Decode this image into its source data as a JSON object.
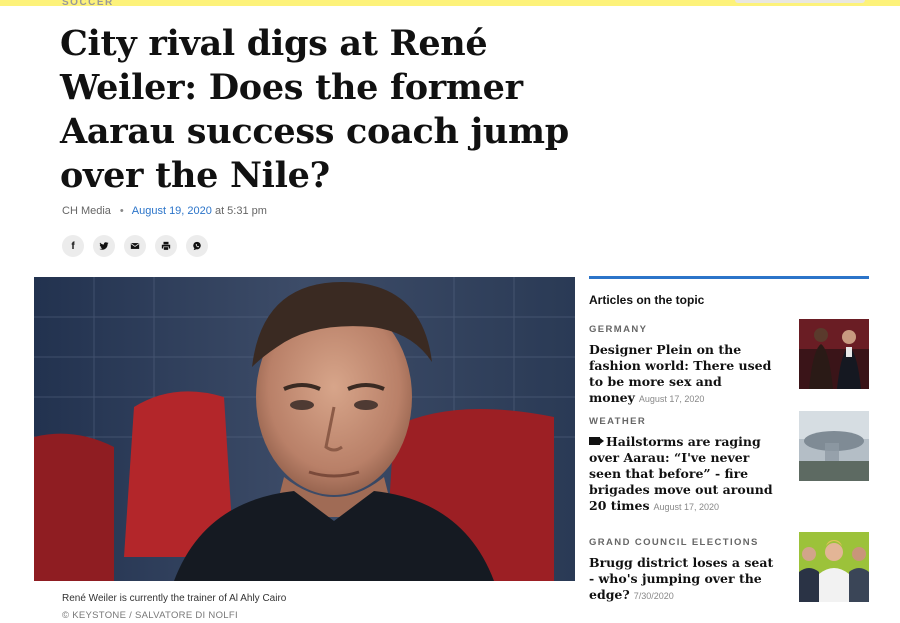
{
  "article": {
    "section": "SOCCER",
    "headline": "City rival digs at René Weiler: Does the former Aarau success coach jump over the Nile?",
    "author": "CH Media",
    "date": "August 19, 2020",
    "time_prefix": "at 5:31 pm",
    "image_caption": "René Weiler is currently the trainer of Al Ahly Cairo",
    "image_credit": "© KEYSTONE / SALVATORE DI NOLFI"
  },
  "share": {
    "facebook": "f",
    "twitter_icon": "twitter-icon",
    "email_icon": "mail-icon",
    "print_icon": "print-icon",
    "whatsapp_icon": "whatsapp-icon"
  },
  "sidebar": {
    "title": "Articles on the topic",
    "accent_color": "#2b74c9",
    "items": [
      {
        "category": "GERMANY",
        "title": "Designer Plein on the fashion world: There used to be more sex and money",
        "date": "August 17, 2020",
        "has_video": false
      },
      {
        "category": "WEATHER",
        "title": "Hailstorms are raging over Aarau: “I've never seen that before” - fire brigades move out around 20 times",
        "date": "August 17, 2020",
        "has_video": true
      },
      {
        "category": "GRAND COUNCIL ELECTIONS",
        "title": "Brugg district loses a seat - who's jumping over the edge?",
        "date": "7/30/2020",
        "has_video": false
      }
    ]
  }
}
